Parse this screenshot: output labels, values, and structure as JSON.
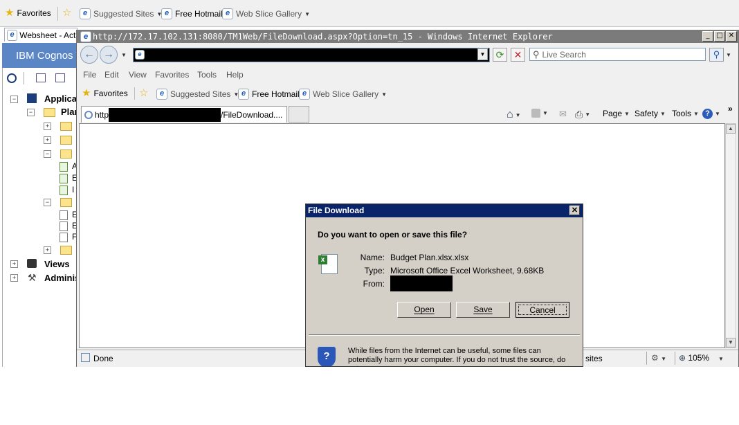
{
  "outer_favorites_bar": {
    "favorites": "Favorites",
    "suggested_sites": "Suggested Sites",
    "free_hotmail": "Free Hotmail",
    "web_slice_gallery": "Web Slice Gallery"
  },
  "background_window": {
    "tab_title": "Websheet - Actu",
    "header": "IBM Cognos T",
    "tree": [
      {
        "label": "Applicat"
      },
      {
        "label": "Plar"
      },
      {
        "label": "A"
      },
      {
        "label": "E"
      },
      {
        "label": "I"
      },
      {
        "label": "E"
      },
      {
        "label": "E"
      },
      {
        "label": "F"
      },
      {
        "label": "Views"
      },
      {
        "label": "Adminis"
      }
    ]
  },
  "ie_window": {
    "title": "http://172.17.102.131:8080/TM1Web/FileDownload.aspx?Option=tn_15 - Windows Internet Explorer",
    "search_placeholder": "Live Search",
    "menu": [
      "File",
      "Edit",
      "View",
      "Favorites",
      "Tools",
      "Help"
    ],
    "favorites": "Favorites",
    "suggested_sites": "Suggested Sites",
    "free_hotmail": "Free Hotmail",
    "web_slice_gallery": "Web Slice Gallery",
    "tab_prefix": "http",
    "tab_suffix": "/FileDownload....",
    "command_bar": {
      "page": "Page",
      "safety": "Safety",
      "tools": "Tools"
    },
    "status": {
      "text": "Done",
      "zone": "sites",
      "zoom": "105%"
    }
  },
  "dialog": {
    "title": "File Download",
    "question": "Do you want to open or save this file?",
    "name_label": "Name:",
    "name_value": "Budget Plan.xlsx.xlsx",
    "type_label": "Type:",
    "type_value": "Microsoft Office Excel Worksheet, 9.68KB",
    "from_label": "From:",
    "buttons": {
      "open": "Open",
      "save": "Save",
      "cancel": "Cancel"
    },
    "warning": "While files from the Internet can be useful, some files can potentially harm your computer. If you do not trust the source, do not open or"
  },
  "colors": {
    "dialog_title_bg": "#0a246a",
    "window_title_bg": "#7b7b7b",
    "cognos_header_bg": "#5b86c6"
  }
}
